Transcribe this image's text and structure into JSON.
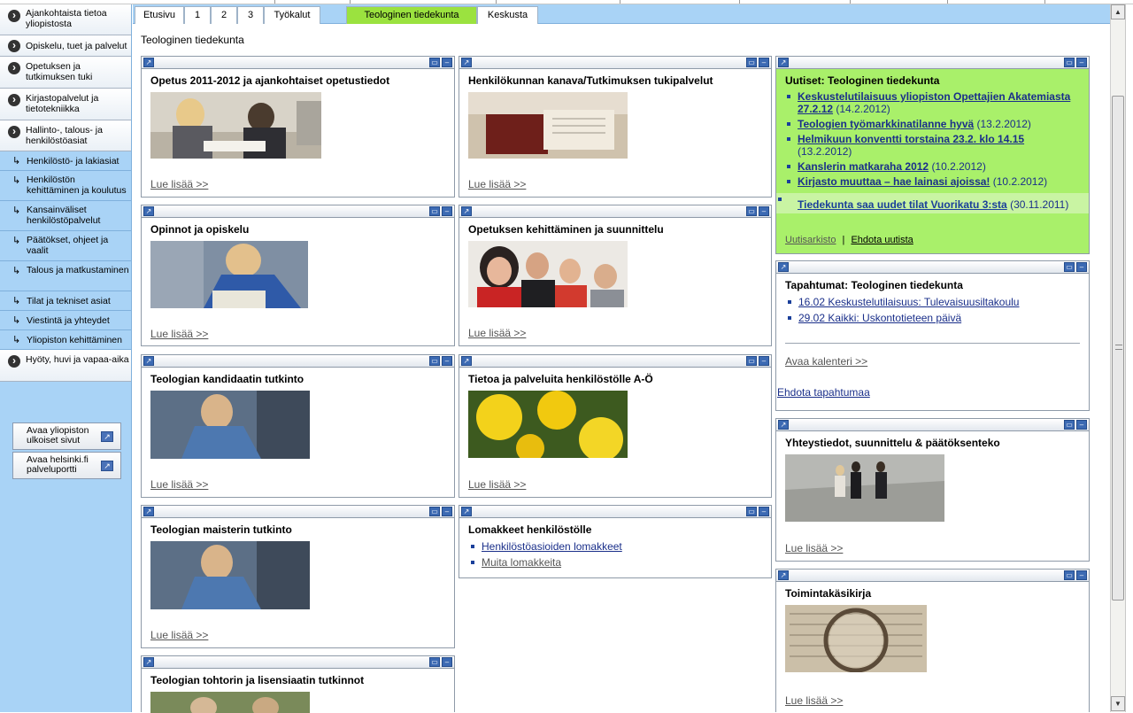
{
  "sidebar": {
    "items": [
      {
        "label": "Ajankohtaista tietoa yliopistosta",
        "type": "main"
      },
      {
        "label": "Opiskelu, tuet ja palvelut",
        "type": "main"
      },
      {
        "label": "Opetuksen ja tutkimuksen tuki",
        "type": "main"
      },
      {
        "label": "Kirjastopalvelut ja tietotekniikka",
        "type": "main"
      },
      {
        "label": "Hallinto-, talous- ja henkilöstöasiat",
        "type": "main"
      },
      {
        "label": "Henkilöstö- ja lakiasiat",
        "type": "sub"
      },
      {
        "label": "Henkilöstön kehittäminen ja koulutus",
        "type": "sub"
      },
      {
        "label": "Kansainväliset henkilöstöpalvelut",
        "type": "sub"
      },
      {
        "label": "Päätökset, ohjeet ja vaalit",
        "type": "sub"
      },
      {
        "label": "Talous ja matkustaminen",
        "type": "sub"
      },
      {
        "label": "Tilat ja tekniset asiat",
        "type": "sub"
      },
      {
        "label": "Viestintä ja yhteydet",
        "type": "sub"
      },
      {
        "label": "Yliopiston kehittäminen",
        "type": "sub"
      },
      {
        "label": "Hyöty, huvi ja vapaa-aika",
        "type": "main"
      }
    ],
    "ext_buttons": [
      {
        "label": "Avaa yliopiston ulkoiset sivut"
      },
      {
        "label": "Avaa helsinki.fi palveluportti"
      }
    ]
  },
  "tabs": [
    {
      "label": "Etusivu"
    },
    {
      "label": "1"
    },
    {
      "label": "2"
    },
    {
      "label": "3"
    },
    {
      "label": "Työkalut"
    },
    {
      "label": "Teologinen tiedekunta",
      "active": true
    },
    {
      "label": "Keskusta"
    }
  ],
  "page_title": "Teologinen tiedekunta",
  "more_label": "Lue lisää >>",
  "col1": [
    {
      "title": "Opetus 2011-2012 ja ajankohtaiset opetustiedot"
    },
    {
      "title": "Opinnot ja opiskelu"
    },
    {
      "title": "Teologian kandidaatin tutkinto"
    },
    {
      "title": "Teologian maisterin tutkinto"
    },
    {
      "title": "Teologian tohtorin ja lisensiaatin tutkinnot"
    }
  ],
  "col2": [
    {
      "title": "Henkilökunnan kanava/Tutkimuksen tukipalvelut"
    },
    {
      "title": "Opetuksen kehittäminen ja suunnittelu"
    },
    {
      "title": "Tietoa ja palveluita henkilöstölle A-Ö"
    },
    {
      "title": "Lomakkeet henkilöstölle",
      "links": [
        "Henkilöstöasioiden lomakkeet",
        "Muita lomakkeita"
      ]
    }
  ],
  "news": {
    "title": "Uutiset: Teologinen tiedekunta",
    "items": [
      {
        "text": "Keskustelutilaisuus yliopiston Opettajien Akatemiasta 27.2.12",
        "date": "(14.2.2012)"
      },
      {
        "text": "Teologien työmarkkinatilanne hyvä",
        "date": "(13.2.2012)"
      },
      {
        "text": "Helmikuun konventti torstaina 23.2. klo 14.15",
        "date": "(13.2.2012)"
      },
      {
        "text": "Kanslerin matkaraha 2012",
        "date": "(10.2.2012)"
      },
      {
        "text": "Kirjasto muuttaa – hae lainasi ajoissa!",
        "date": "(10.2.2012)"
      },
      {
        "text": "Tiedekunta saa uudet tilat Vuorikatu 3:sta",
        "date": "(30.11.2011)",
        "old": true
      }
    ],
    "archive_label": "Uutisarkisto",
    "separator": "|",
    "suggest_label": "Ehdota uutista"
  },
  "events": {
    "title": "Tapahtumat: Teologinen tiedekunta",
    "items": [
      "16.02 Keskustelutilaisuus: Tulevaisuusiltakoulu",
      "29.02 Kaikki: Uskontotieteen päivä"
    ],
    "calendar_label": "Avaa kalenteri >>",
    "suggest_label": "Ehdota tapahtumaa"
  },
  "contacts": {
    "title": "Yhteystiedot, suunnittelu & päätöksenteko"
  },
  "handbook": {
    "title": "Toimintakäsikirja"
  },
  "colors": {
    "sidebar_bg": "#a9d3f6",
    "active_tab": "#9be23f",
    "news_bg": "#a9f06a",
    "link": "#1a2f8a"
  },
  "icons": {
    "portlet_link": "arrow-up-right-icon",
    "minimize": "minimize-icon",
    "restore": "restore-icon",
    "nav_bullet": "chevron-circle-icon",
    "sub_bullet": "corner-arrow-icon"
  }
}
